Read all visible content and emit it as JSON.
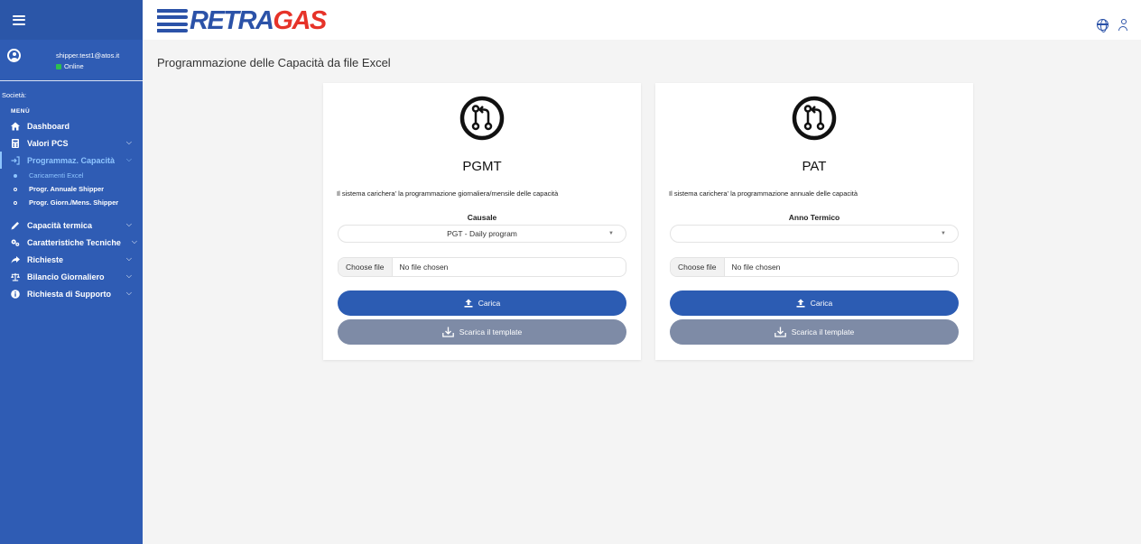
{
  "header": {
    "logo_retra": "RETRA",
    "logo_gas": "GAS"
  },
  "user": {
    "email": "shipper.test1@atos.it",
    "status": "Online"
  },
  "sidebar": {
    "societa_label": "Società:",
    "menu_label": "MENÙ",
    "items": [
      {
        "label": "Dashboard"
      },
      {
        "label": "Valori PCS"
      },
      {
        "label": "Programmaz. Capacità"
      },
      {
        "label": "Capacità termica"
      },
      {
        "label": "Caratteristiche Tecniche"
      },
      {
        "label": "Richieste"
      },
      {
        "label": "Bilancio Giornaliero"
      },
      {
        "label": "Richiesta di Supporto"
      }
    ],
    "subitems": [
      {
        "label": "Caricamenti Excel"
      },
      {
        "label": "Progr. Annuale Shipper"
      },
      {
        "label": "Progr. Giorn./Mens. Shipper"
      }
    ]
  },
  "page": {
    "title": "Programmazione delle Capacità da file Excel"
  },
  "cards": [
    {
      "title": "PGMT",
      "description": "Il sistema carichera' la programmazione giornaliera/mensile delle capacità",
      "field_label": "Causale",
      "select_value": "PGT - Daily program",
      "file_button": "Choose file",
      "file_text": "No file chosen",
      "upload_label": "Carica",
      "template_label": "Scarica il template"
    },
    {
      "title": "PAT",
      "description": "Il sistema carichera' la programmazione annuale delle capacità",
      "field_label": "Anno Termico",
      "select_value": "",
      "file_button": "Choose file",
      "file_text": "No file chosen",
      "upload_label": "Carica",
      "template_label": "Scarica il template"
    }
  ],
  "colors": {
    "sidebar": "#2f5cb4",
    "primary_button": "#2c5cb3",
    "secondary_button": "#7e8ba6",
    "active_nav": "#8ec5ff",
    "online": "#2ec04e",
    "logo_blue": "#2b52a8",
    "logo_red": "#e63329"
  },
  "icons": {
    "menu": "hamburger-icon",
    "card": "git-compare-icon",
    "upload": "upload-icon",
    "download": "download-icon",
    "language": "globe-icon",
    "account": "person-icon"
  }
}
